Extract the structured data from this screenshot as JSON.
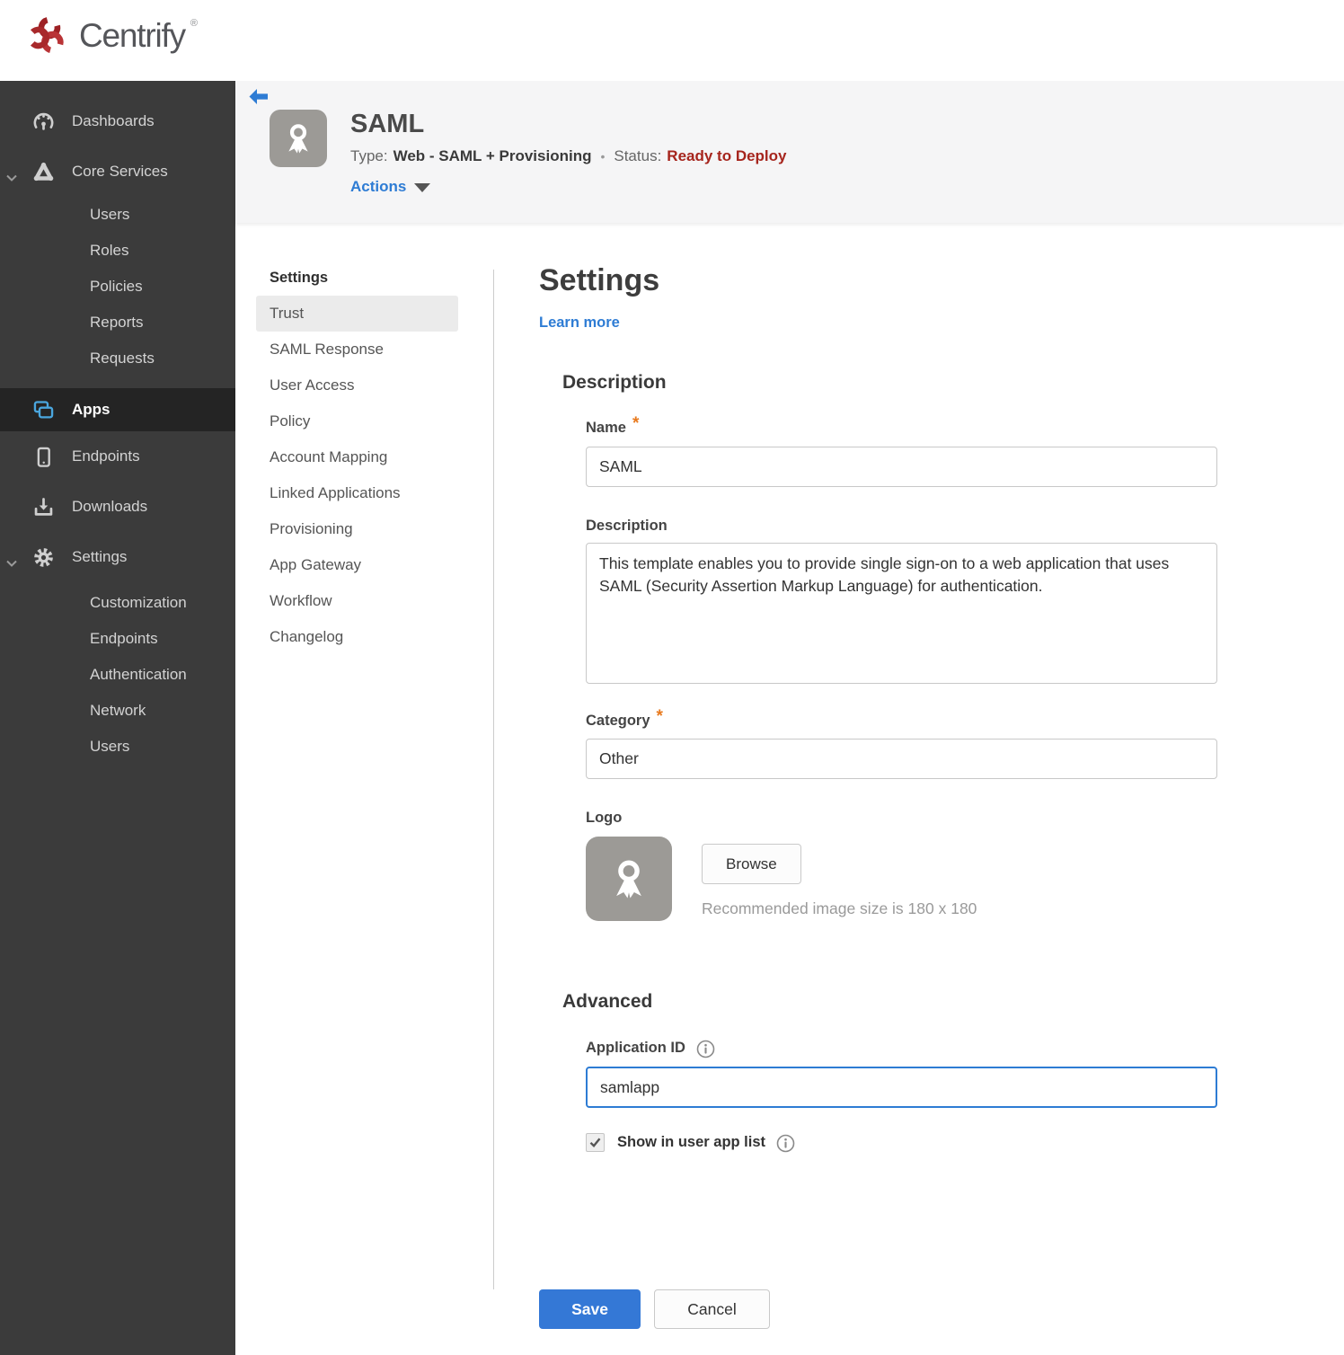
{
  "brand": {
    "name": "Centrify",
    "reg": "®"
  },
  "sidebar": {
    "dashboards": "Dashboards",
    "core_services": "Core Services",
    "core_children": [
      "Users",
      "Roles",
      "Policies",
      "Reports",
      "Requests"
    ],
    "apps": "Apps",
    "endpoints": "Endpoints",
    "downloads": "Downloads",
    "settings": "Settings",
    "settings_children": [
      "Customization",
      "Endpoints",
      "Authentication",
      "Network",
      "Users"
    ]
  },
  "header": {
    "title": "SAML",
    "type_label": "Type:",
    "type_value": "Web - SAML + Provisioning",
    "dot": "•",
    "status_label": "Status:",
    "status_value": "Ready to Deploy",
    "actions": "Actions"
  },
  "subnav": {
    "header": "Settings",
    "selected": "Trust",
    "items": [
      "Trust",
      "SAML Response",
      "User Access",
      "Policy",
      "Account Mapping",
      "Linked Applications",
      "Provisioning",
      "App Gateway",
      "Workflow",
      "Changelog"
    ]
  },
  "main": {
    "title": "Settings",
    "learn_more": "Learn more",
    "required": "*",
    "description_section": {
      "heading": "Description",
      "name_label": "Name",
      "name_value": "SAML",
      "desc_label": "Description",
      "desc_value": "This template enables you to provide single sign-on to a web application that uses SAML (Security Assertion Markup Language) for authentication.",
      "category_label": "Category",
      "category_value": "Other",
      "logo_label": "Logo",
      "browse": "Browse",
      "logo_hint": "Recommended image size is 180 x 180"
    },
    "advanced_section": {
      "heading": "Advanced",
      "app_id_label": "Application ID",
      "app_id_value": "samlapp",
      "checkbox_label": "Show in user app list",
      "checkbox_state": "checked"
    },
    "footer": {
      "save": "Save",
      "cancel": "Cancel"
    }
  },
  "colors": {
    "accent_blue": "#2e7cd4",
    "save_blue": "#3478d6",
    "status_red": "#a6251d",
    "brand_red": "#a8292b",
    "apps_icon_blue": "#4aa6de",
    "sidebar_bg": "#3b3b3b"
  }
}
